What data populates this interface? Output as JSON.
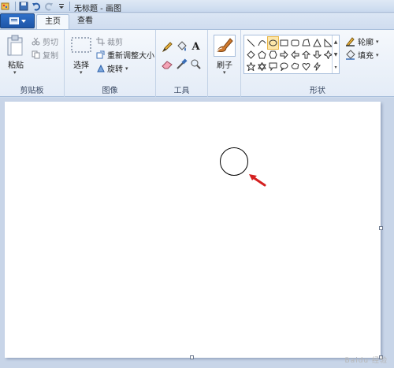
{
  "window": {
    "title": "无标题 - 画图"
  },
  "tabs": [
    {
      "label": "主页",
      "active": true
    },
    {
      "label": "查看",
      "active": false
    }
  ],
  "clipboard": {
    "paste_label": "粘贴",
    "cut_label": "剪切",
    "copy_label": "复制",
    "group_label": "剪贴板"
  },
  "image": {
    "select_label": "选择",
    "crop_label": "裁剪",
    "resize_label": "重新调整大小",
    "rotate_label": "旋转",
    "group_label": "图像"
  },
  "tools": {
    "group_label": "工具",
    "icons": [
      "pencil-icon",
      "fill-icon",
      "text-icon",
      "eraser-icon",
      "color-picker-icon",
      "magnifier-icon"
    ],
    "text_tool_glyph": "A"
  },
  "brushes": {
    "label": "刷子"
  },
  "shapes": {
    "group_label": "形状",
    "outline_label": "轮廓",
    "fill_label": "填充",
    "selected_shape": "oval"
  },
  "colors": {
    "accent_blue": "#1d56a8",
    "selected_shape": "#fde6a8",
    "annotation_arrow": "#d41f1f",
    "canvas": "#ffffff"
  }
}
